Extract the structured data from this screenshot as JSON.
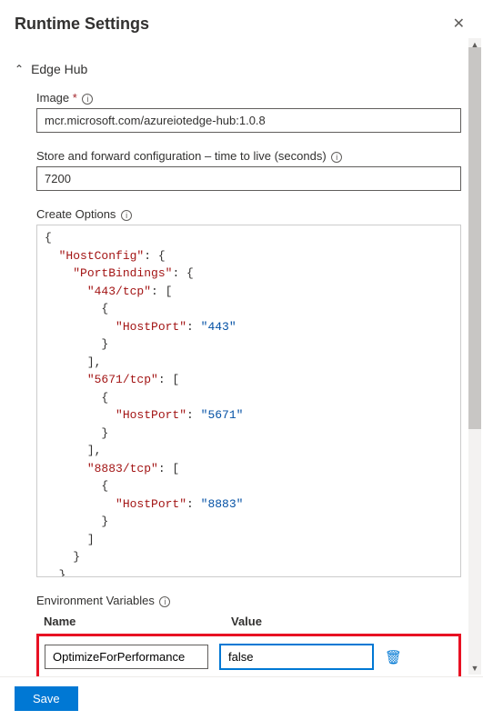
{
  "panel": {
    "title": "Runtime Settings"
  },
  "section": {
    "title": "Edge Hub"
  },
  "image": {
    "label": "Image",
    "value": "mcr.microsoft.com/azureiotedge-hub:1.0.8"
  },
  "ttl": {
    "label": "Store and forward configuration – time to live (seconds)",
    "value": "7200"
  },
  "createOptions": {
    "label": "Create Options",
    "json": {
      "HostConfig": {
        "PortBindings": {
          "443/tcp": [
            {
              "HostPort": "443"
            }
          ],
          "5671/tcp": [
            {
              "HostPort": "5671"
            }
          ],
          "8883/tcp": [
            {
              "HostPort": "8883"
            }
          ]
        }
      }
    }
  },
  "envVars": {
    "label": "Environment Variables",
    "columns": {
      "name": "Name",
      "value": "Value"
    },
    "rows": [
      {
        "name": "OptimizeForPerformance",
        "value": "false"
      }
    ]
  },
  "footer": {
    "save": "Save"
  }
}
